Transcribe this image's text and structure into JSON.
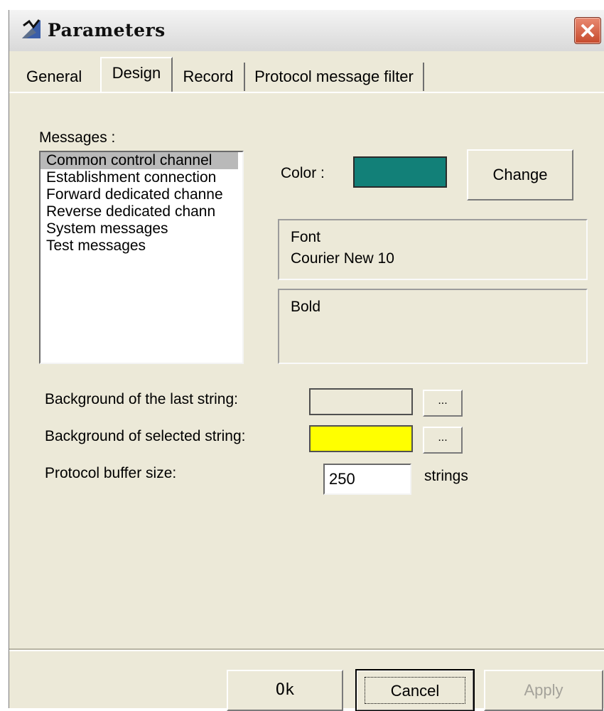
{
  "window": {
    "title": "Parameters"
  },
  "tabs": [
    {
      "label": "General"
    },
    {
      "label": "Design"
    },
    {
      "label": "Record"
    },
    {
      "label": "Protocol message filter"
    }
  ],
  "messages": {
    "label": "Messages :",
    "items": [
      "Common control channel",
      "Establishment connection",
      "Forward dedicated channe",
      "Reverse dedicated chann",
      "System messages",
      "Test messages"
    ],
    "selected_index": 0
  },
  "color": {
    "label": "Color :",
    "value": "#128078",
    "change_button": "Change"
  },
  "font": {
    "heading": "Font",
    "value": "Courier New 10"
  },
  "style": {
    "value": "Bold"
  },
  "settings": {
    "last_string_label": "Background of the last string:",
    "last_string_color": "#ece9d8",
    "selected_string_label": "Background of selected string:",
    "selected_string_color": "#ffff00",
    "ellipsis_label": "...",
    "buffer_label": "Protocol buffer size:",
    "buffer_value": "250",
    "buffer_units": "strings"
  },
  "buttons": {
    "ok": "Ok",
    "cancel": "Cancel",
    "apply": "Apply"
  },
  "colors": {
    "close_button": "#d35a3c"
  }
}
